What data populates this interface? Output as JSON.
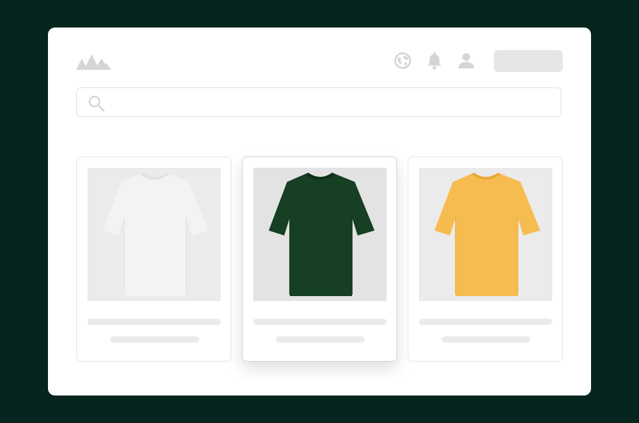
{
  "header": {
    "logo_icon": "mountain-logo-icon",
    "icons": [
      "globe-icon",
      "bell-icon",
      "user-icon"
    ],
    "cta_label": ""
  },
  "search": {
    "icon": "search-icon",
    "placeholder": "",
    "value": ""
  },
  "products": [
    {
      "name": "",
      "price": "",
      "shirt_color": "#f3f3f3",
      "selected": false
    },
    {
      "name": "",
      "price": "",
      "shirt_color": "#163f23",
      "selected": true
    },
    {
      "name": "",
      "price": "",
      "shirt_color": "#f7bc50",
      "selected": false
    }
  ],
  "colors": {
    "frame_background": "#06251f",
    "window_background": "#ffffff",
    "placeholder_gray": "#ebebeb",
    "icon_gray": "#d5d5d5"
  }
}
